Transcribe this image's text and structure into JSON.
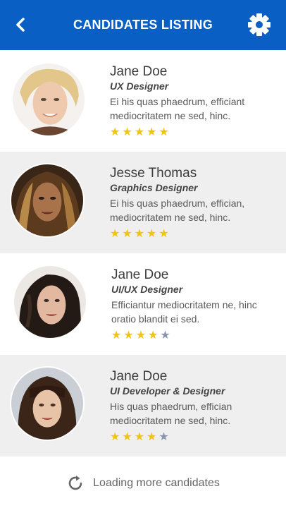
{
  "header": {
    "title": "CANDIDATES LISTING",
    "back_icon": "chevron-left-icon",
    "settings_icon": "gear-icon",
    "bg_color": "#0a5fc4"
  },
  "candidates": [
    {
      "name": "Jane Doe",
      "role": "UX Designer",
      "description": "Ei his quas phaedrum, efficiant mediocritatem ne sed, hinc.",
      "rating": 5,
      "max_rating": 5
    },
    {
      "name": "Jesse Thomas",
      "role": "Graphics Designer",
      "description": "Ei his quas phaedrum, effician, mediocritatem ne sed, hinc.",
      "rating": 5,
      "max_rating": 5
    },
    {
      "name": "Jane Doe",
      "role": "UI/UX Designer",
      "description": "Efficiantur mediocritatem ne, hinc oratio blandit ei sed.",
      "rating": 4,
      "max_rating": 5
    },
    {
      "name": "Jane Doe",
      "role": "UI Developer & Designer",
      "description": "His quas phaedrum, effician mediocritatem ne sed, hinc.",
      "rating": 4,
      "max_rating": 5
    }
  ],
  "footer": {
    "loading_text": "Loading more candidates",
    "loading_icon": "refresh-icon"
  },
  "colors": {
    "star_on": "#f1c40f",
    "star_off": "#8a96ab"
  }
}
